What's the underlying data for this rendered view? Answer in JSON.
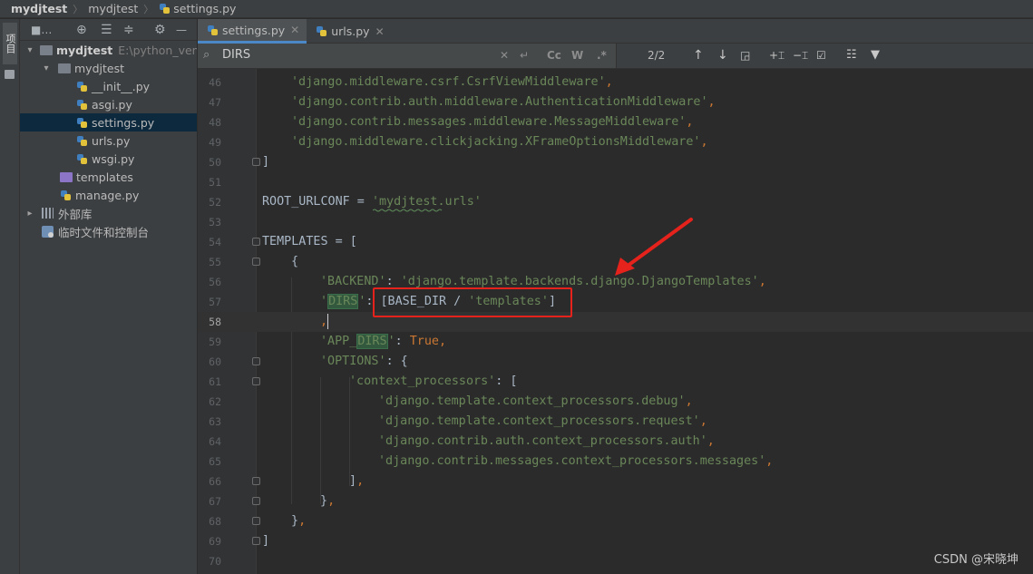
{
  "breadcrumb": {
    "project": "mydjtest",
    "folder": "mydjtest",
    "file": "settings.py"
  },
  "side_strip": {
    "label": "项目"
  },
  "project_panel": {
    "title": "■…",
    "tree": [
      {
        "label": "mydjtest",
        "hint": "E:\\python_venv\\",
        "type": "project"
      },
      {
        "label": "mydjtest",
        "type": "package"
      },
      {
        "label": "__init__.py",
        "type": "py"
      },
      {
        "label": "asgi.py",
        "type": "py"
      },
      {
        "label": "settings.py",
        "type": "py",
        "selected": true
      },
      {
        "label": "urls.py",
        "type": "py"
      },
      {
        "label": "wsgi.py",
        "type": "py"
      },
      {
        "label": "templates",
        "type": "folder"
      },
      {
        "label": "manage.py",
        "type": "py"
      },
      {
        "label": "外部库",
        "type": "lib"
      },
      {
        "label": "临时文件和控制台",
        "type": "scratch"
      }
    ]
  },
  "tabs": [
    {
      "label": "settings.py",
      "active": true
    },
    {
      "label": "urls.py",
      "active": false
    }
  ],
  "search": {
    "query": "DIRS",
    "match_case": "Cc",
    "words": "W",
    "regex": ".*",
    "count": "2/2"
  },
  "code_lines": [
    {
      "n": "46"
    },
    {
      "n": "47"
    },
    {
      "n": "48"
    },
    {
      "n": "49"
    },
    {
      "n": "50"
    },
    {
      "n": "51"
    },
    {
      "n": "52"
    },
    {
      "n": "53"
    },
    {
      "n": "54"
    },
    {
      "n": "55"
    },
    {
      "n": "56"
    },
    {
      "n": "57"
    },
    {
      "n": "58"
    },
    {
      "n": "59"
    },
    {
      "n": "60"
    },
    {
      "n": "61"
    },
    {
      "n": "62"
    },
    {
      "n": "63"
    },
    {
      "n": "64"
    },
    {
      "n": "65"
    },
    {
      "n": "66"
    },
    {
      "n": "67"
    },
    {
      "n": "68"
    },
    {
      "n": "69"
    },
    {
      "n": "70"
    }
  ],
  "code_text": {
    "l46": "'django.middleware.csrf.CsrfViewMiddleware'",
    "l47": "'django.contrib.auth.middleware.AuthenticationMiddleware'",
    "l48": "'django.contrib.messages.middleware.MessageMiddleware'",
    "l49": "'django.middleware.clickjacking.XFrameOptionsMiddleware'",
    "l52a": "ROOT_URLCONF = ",
    "l52b": "'mydjtest.urls'",
    "l54": "TEMPLATES = [",
    "l56a": "'BACKEND'",
    "l56b": "'django.template.backends.django.DjangoTemplates'",
    "l57a": "DIRS",
    "l57b": "[BASE_DIR / ",
    "l57c": "'templates'",
    "l59a": "'APP_",
    "l59b": "DIRS",
    "l59c": "True",
    "l60": "'OPTIONS'",
    "l61": "'context_processors'",
    "l62": "'django.template.context_processors.debug'",
    "l63": "'django.template.context_processors.request'",
    "l64": "'django.contrib.auth.context_processors.auth'",
    "l65": "'django.contrib.messages.context_processors.messages'"
  },
  "colors": {
    "string": "#6a8759",
    "keyword": "#cc7832",
    "text": "#a9b7c6",
    "annotation": "#e5221b"
  },
  "watermark": "CSDN @宋晓坤"
}
